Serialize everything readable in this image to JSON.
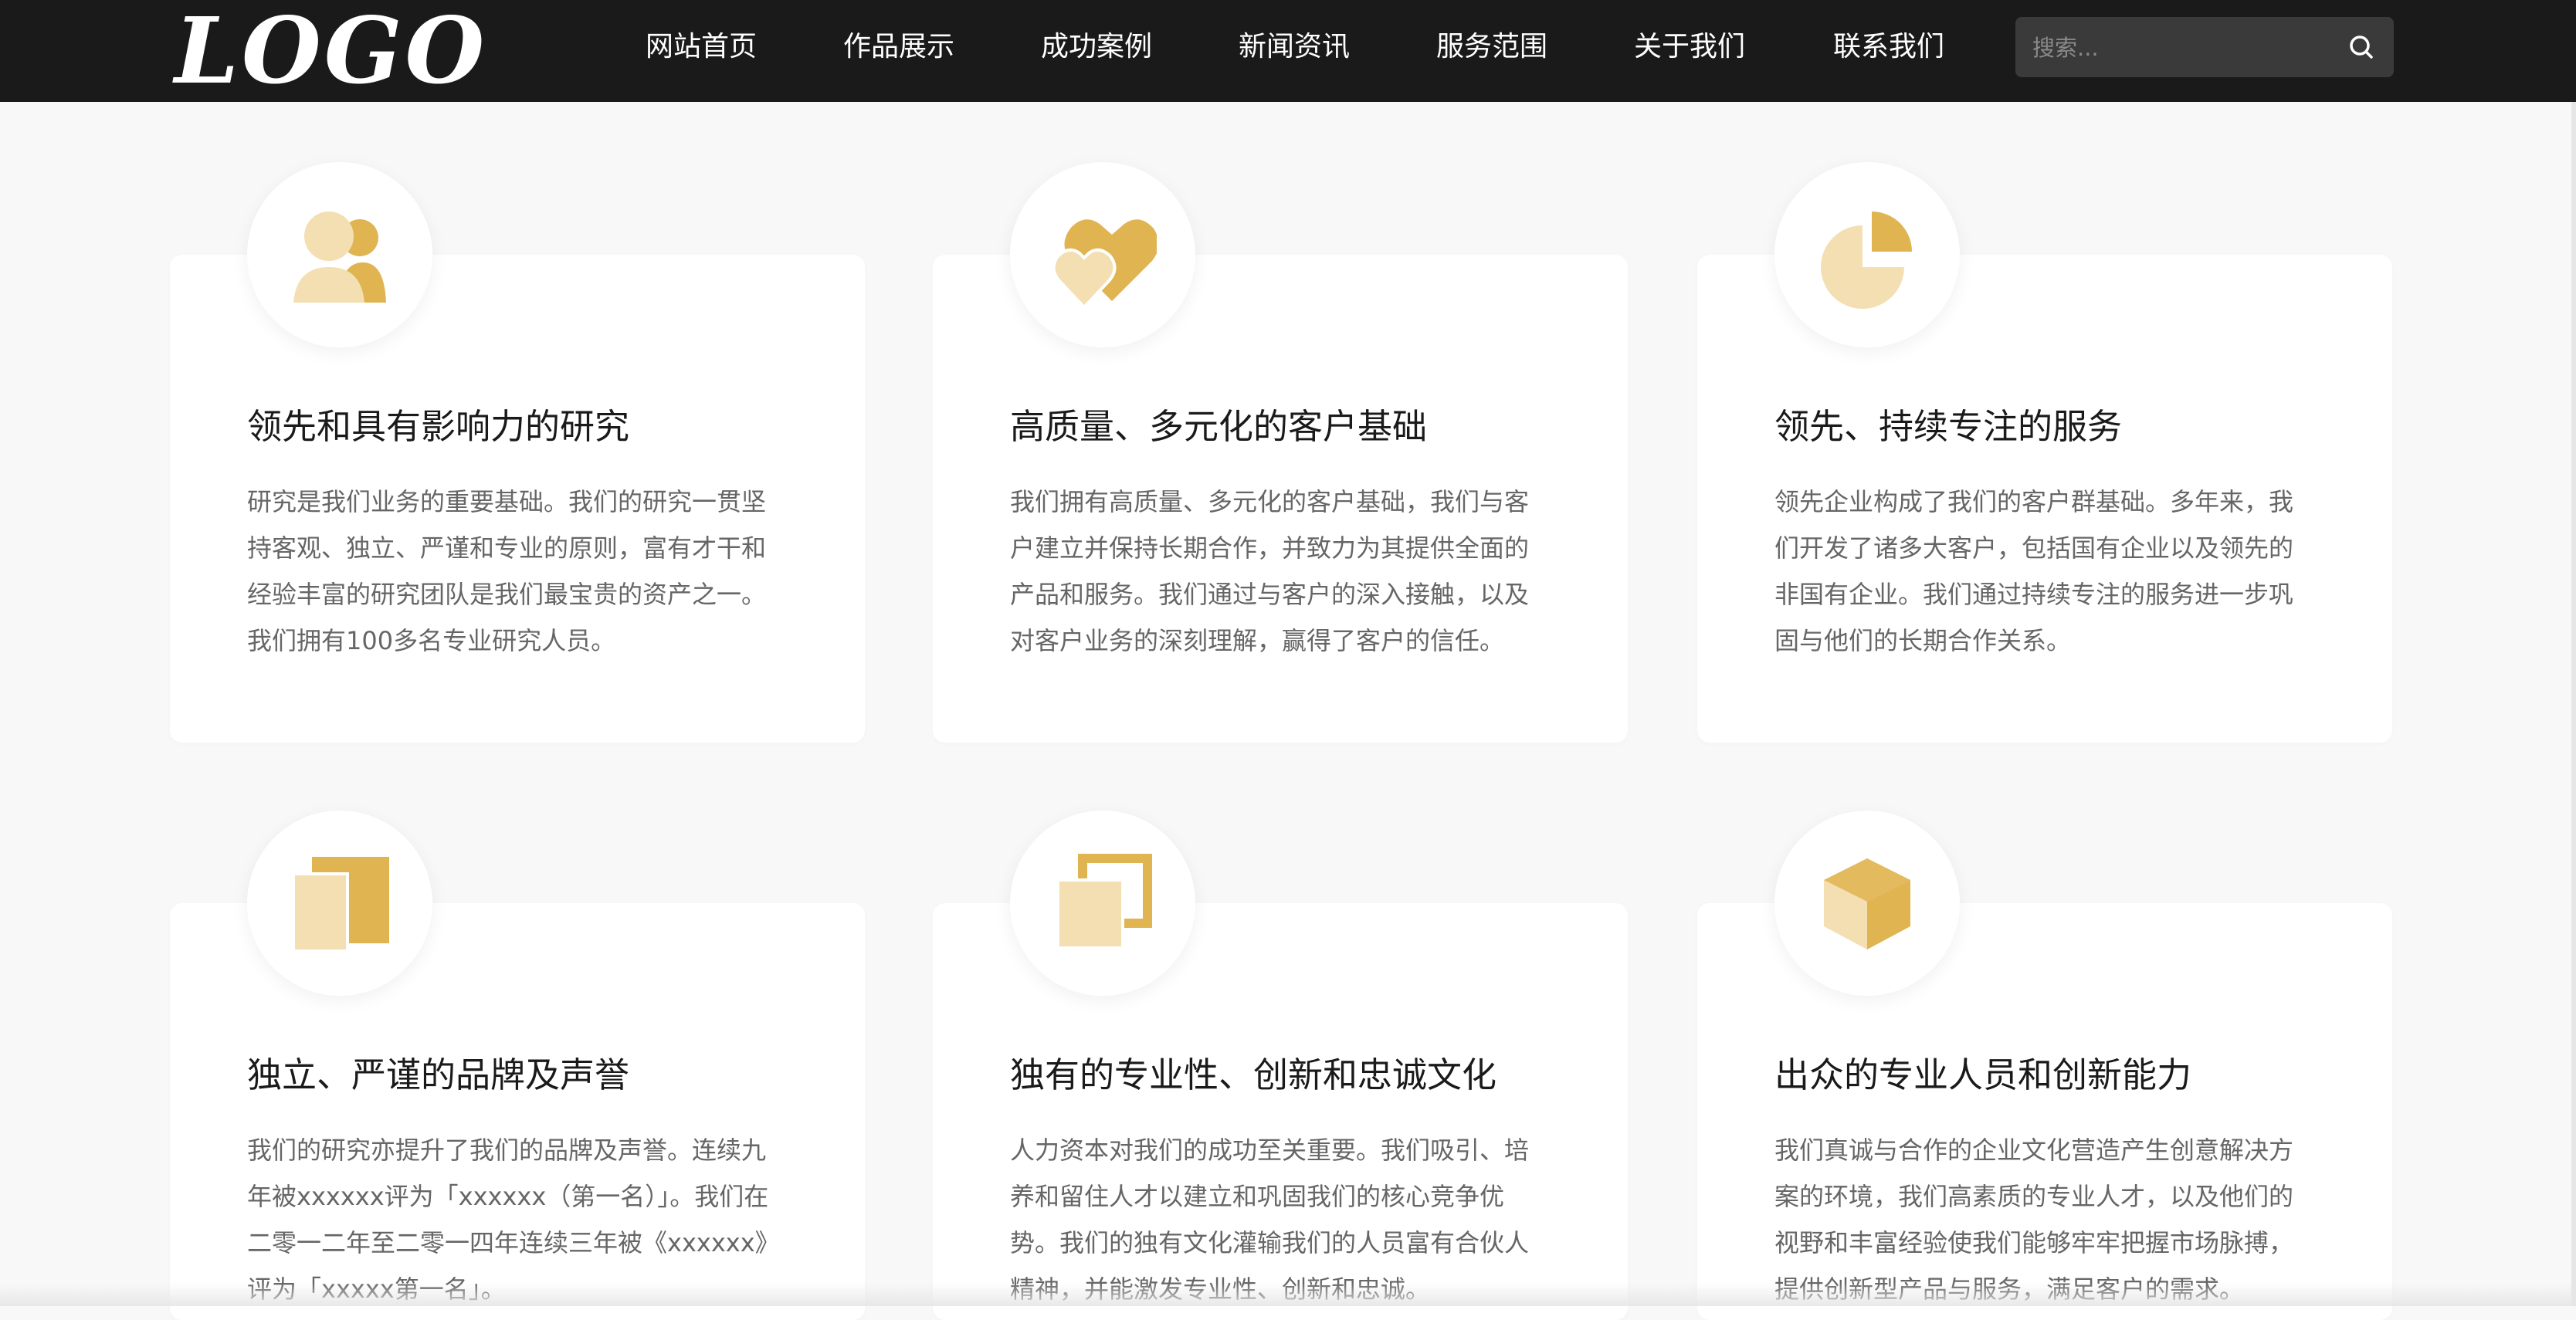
{
  "header": {
    "logo": "LOGO",
    "nav": [
      {
        "label": "网站首页"
      },
      {
        "label": "作品展示"
      },
      {
        "label": "成功案例"
      },
      {
        "label": "新闻资讯"
      },
      {
        "label": "服务范围"
      },
      {
        "label": "关于我们"
      },
      {
        "label": "联系我们"
      }
    ],
    "search": {
      "placeholder": "搜索...",
      "icon": "search-icon"
    }
  },
  "colors": {
    "accent": "#e0b451",
    "accent_light": "#f3dfb1",
    "header_bg": "#1a1a1a",
    "page_bg": "#f8f8f8"
  },
  "features": [
    {
      "icon": "users-icon",
      "title": "领先和具有影响力的研究",
      "lines": [
        "研究是我们业务的重要基础。我们的研究一贯坚",
        "持客观、独立、严谨和专业的原则，富有才干和",
        "经验丰富的研究团队是我们最宝贵的资产之一。",
        "我们拥有100多名专业研究人员。"
      ]
    },
    {
      "icon": "hearts-icon",
      "title": "高质量、多元化的客户基础",
      "lines": [
        "我们拥有高质量、多元化的客户基础，我们与客",
        "户建立并保持长期合作，并致力为其提供全面的",
        "产品和服务。我们通过与客户的深入接触，以及",
        "对客户业务的深刻理解，赢得了客户的信任。"
      ]
    },
    {
      "icon": "pie-chart-icon",
      "title": "领先、持续专注的服务",
      "lines": [
        "领先企业构成了我们的客户群基础。多年来，我",
        "们开发了诸多大客户，包括国有企业以及领先的",
        "非国有企业。我们通过持续专注的服务进一步巩",
        "固与他们的长期合作关系。"
      ]
    },
    {
      "icon": "documents-icon",
      "title": "独立、严谨的品牌及声誉",
      "lines": [
        "我们的研究亦提升了我们的品牌及声誉。连续九",
        "年被xxxxxx评为「xxxxxx（第一名）」。我们在",
        "二零一二年至二零一四年连续三年被《xxxxxx》",
        "评为「xxxxx第一名」。"
      ]
    },
    {
      "icon": "squares-icon",
      "title": "独有的专业性、创新和忠诚文化",
      "lines": [
        "人力资本对我们的成功至关重要。我们吸引、培",
        "养和留住人才以建立和巩固我们的核心竞争优",
        "势。我们的独有文化灌输我们的人员富有合伙人",
        "精神，并能激发专业性、创新和忠诚。"
      ]
    },
    {
      "icon": "cube-icon",
      "title": "出众的专业人员和创新能力",
      "lines": [
        "我们真诚与合作的企业文化营造产生创意解决方",
        "案的环境，我们高素质的专业人才，以及他们的",
        "视野和丰富经验使我们能够牢牢把握市场脉搏，",
        "提供创新型产品与服务，满足客户的需求。"
      ]
    }
  ]
}
